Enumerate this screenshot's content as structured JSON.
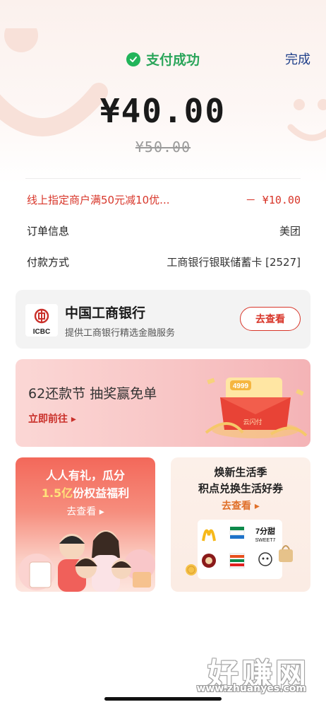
{
  "header": {
    "status_text": "支付成功",
    "done_label": "完成"
  },
  "payment": {
    "amount": "¥40.00",
    "original_amount": "¥50.00"
  },
  "details": {
    "promo_label": "线上指定商户满50元减10优...",
    "promo_value": "－ ¥10.00",
    "order_label": "订单信息",
    "order_value": "美团",
    "method_label": "付款方式",
    "method_value": "工商银行银联储蓄卡 [2527]"
  },
  "bank": {
    "logo_text": "ICBC",
    "name": "中国工商银行",
    "desc": "提供工商银行精选金融服务",
    "button_label": "去查看"
  },
  "banner": {
    "title": "62还款节 抽奖赢免单",
    "link_label": "立即前往 ▸",
    "badge_text": "4999",
    "pay_tag": "云闪付"
  },
  "promo_left": {
    "line1": "人人有礼，瓜分",
    "line2_highlight": "1.5亿",
    "line2_rest": "份权益福利",
    "link_label": "去查看 ▸"
  },
  "promo_right": {
    "line1": "焕新生活季",
    "line2": "积点兑换生活好券",
    "link_label": "去查看 ▸",
    "brand_7": "7分甜",
    "brand_7_sub": "SWEET7"
  },
  "watermark": {
    "text": "好赚网",
    "url": "www.zhuanyes.com"
  },
  "colors": {
    "success_green": "#21b45a",
    "accent_red": "#d8362a",
    "link_blue": "#1f3f8a"
  }
}
